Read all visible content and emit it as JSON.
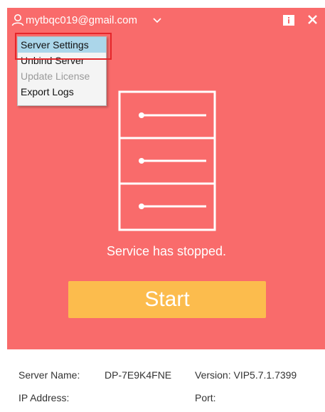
{
  "header": {
    "account_email": "mytbqc019@gmail.com",
    "icons": [
      "user-icon",
      "chevron-down-icon",
      "info-icon",
      "close-icon"
    ]
  },
  "menu": {
    "items": [
      {
        "label": "Server Settings",
        "state": "selected"
      },
      {
        "label": "Unbind Server",
        "state": "normal"
      },
      {
        "label": "Update License",
        "state": "disabled"
      },
      {
        "label": "Export Logs",
        "state": "normal"
      }
    ]
  },
  "main": {
    "status_text": "Service has stopped.",
    "start_label": "Start"
  },
  "footer": {
    "server_name_label": "Server Name:",
    "server_name_value": "DP-7E9K4FNE",
    "version_text": "Version: VIP5.7.1.7399",
    "ip_label": "IP Address:",
    "ip_value": "",
    "port_label": "Port:",
    "port_value": ""
  },
  "colors": {
    "background": "#f96b6b",
    "start_button": "#fcbc4d",
    "menu_selected": "#abd6ea",
    "highlight_border": "#e5262a"
  }
}
